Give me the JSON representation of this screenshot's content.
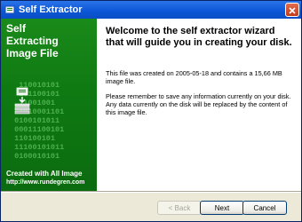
{
  "window": {
    "title": "Self Extractor",
    "accent_color": "#0a56d6",
    "close_icon": "close-icon"
  },
  "side_panel": {
    "title": "Self\nExtracting\nImage File",
    "binary_text": "  110010101\n  101100101\n  11001001\n  1010001101\n 0100101011\n 00011100101\n 110100101\n 11100101011\n 0100010101",
    "footer_line1": "Created with All Image",
    "footer_line2": "http://www.rundegren.com",
    "bg_color": "#1a8a1a"
  },
  "content": {
    "heading": "Welcome to the self extractor wizard that will guide you in creating your disk.",
    "paragraph1": "This file was created on 2005-05-18 and contains a 15,66 MB image file.",
    "paragraph2": "Please remember to save any information currently on your disk. Any data currently on the disk will be replaced by the content of this image file."
  },
  "buttons": {
    "back": "< Back",
    "next": "Next",
    "cancel": "Cancel"
  }
}
